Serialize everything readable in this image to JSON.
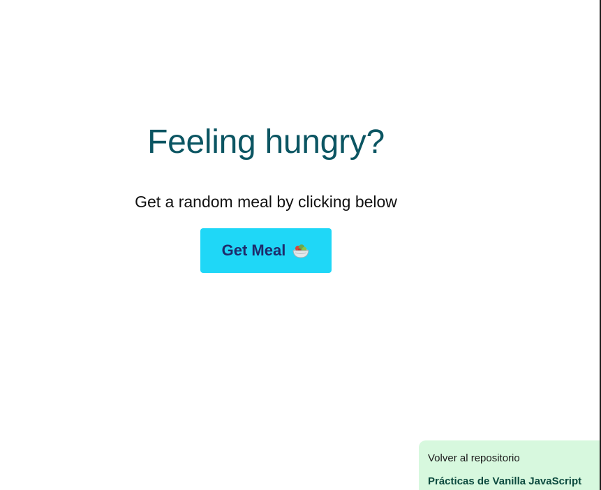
{
  "hero": {
    "title": "Feeling hungry?",
    "subtitle": "Get a random meal by clicking below",
    "button_label": "Get Meal",
    "button_icon": "salad-bowl-icon"
  },
  "repo_panel": {
    "label": "Volver al repositorio",
    "link_text": "Prácticas de Vanilla JavaScript"
  },
  "colors": {
    "title": "#0b5562",
    "button_bg": "#1fd7f7",
    "button_text": "#1e2b6b",
    "panel_bg": "#d7f8de",
    "panel_link": "#0c4a3e"
  }
}
